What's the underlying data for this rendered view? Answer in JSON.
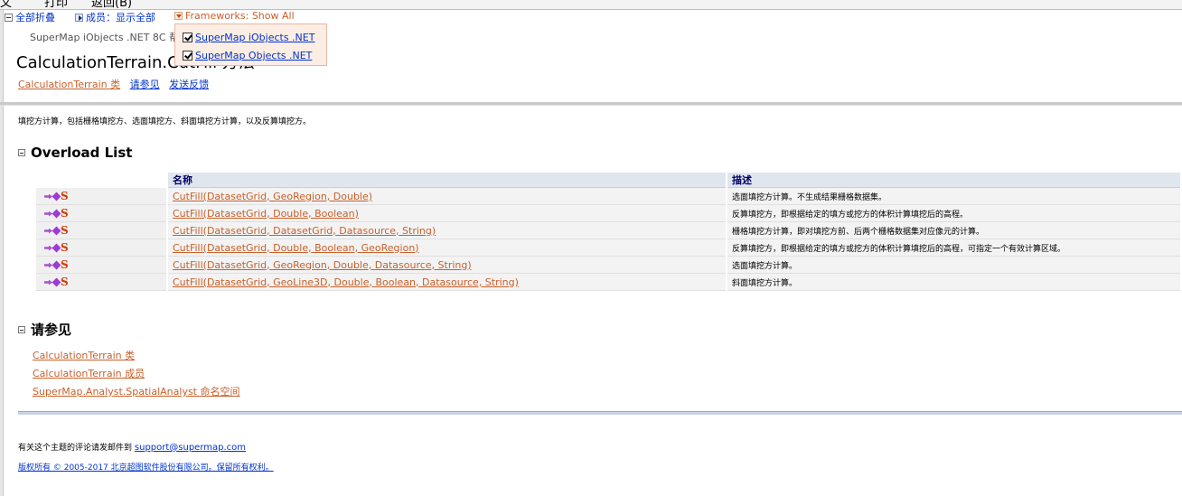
{
  "menu": {
    "items": [
      "文",
      "打印",
      "返回(B)"
    ]
  },
  "toolbar": {
    "collapse_all": "全部折叠",
    "members": "成员：显示全部",
    "frameworks": "Frameworks: Show All"
  },
  "frameworks_popup": {
    "items": [
      {
        "label": "SuperMap iObjects .NET",
        "checked": true
      },
      {
        "label": "SuperMap Objects .NET",
        "checked": true
      }
    ]
  },
  "product": "SuperMap iObjects .NET 8C 帮",
  "title": "CalculationTerrain.CutFill 方法",
  "nav": {
    "class_link": "CalculationTerrain 类",
    "see_also": "请参见",
    "feedback": "发送反馈"
  },
  "summary": "填挖方计算，包括栅格填挖方、选面填挖方、斜面填挖方计算，以及反算填挖方。",
  "overload": {
    "heading": "Overload List",
    "col_name": "名称",
    "col_desc": "描述",
    "rows": [
      {
        "name": "CutFill(DatasetGrid, GeoRegion, Double)",
        "desc": "选面填挖方计算。不生成结果栅格数据集。"
      },
      {
        "name": "CutFill(DatasetGrid, Double, Boolean)",
        "desc": "反算填挖方，即根据给定的填方或挖方的体积计算填挖后的高程。"
      },
      {
        "name": "CutFill(DatasetGrid, DatasetGrid, Datasource, String)",
        "desc": "栅格填挖方计算，即对填挖方前、后两个栅格数据集对应像元的计算。"
      },
      {
        "name": "CutFill(DatasetGrid, Double, Boolean, GeoRegion)",
        "desc": "反算填挖方，即根据给定的填方或挖方的体积计算填挖后的高程，可指定一个有效计算区域。"
      },
      {
        "name": "CutFill(DatasetGrid, GeoRegion, Double, Datasource, String)",
        "desc": "选面填挖方计算。"
      },
      {
        "name": "CutFill(DatasetGrid, GeoLine3D, Double, Boolean, Datasource, String)",
        "desc": "斜面填挖方计算。"
      }
    ]
  },
  "see_also": {
    "heading": "请参见",
    "links": [
      "CalculationTerrain 类",
      "CalculationTerrain 成员",
      "SuperMap.Analyst.SpatialAnalyst 命名空间"
    ]
  },
  "footer": {
    "comment_text": "有关这个主题的评论请发邮件到",
    "email": "support@supermap.com",
    "copyright": "版权所有 © 2005-2017 北京超图软件股份有限公司。保留所有权利。"
  }
}
